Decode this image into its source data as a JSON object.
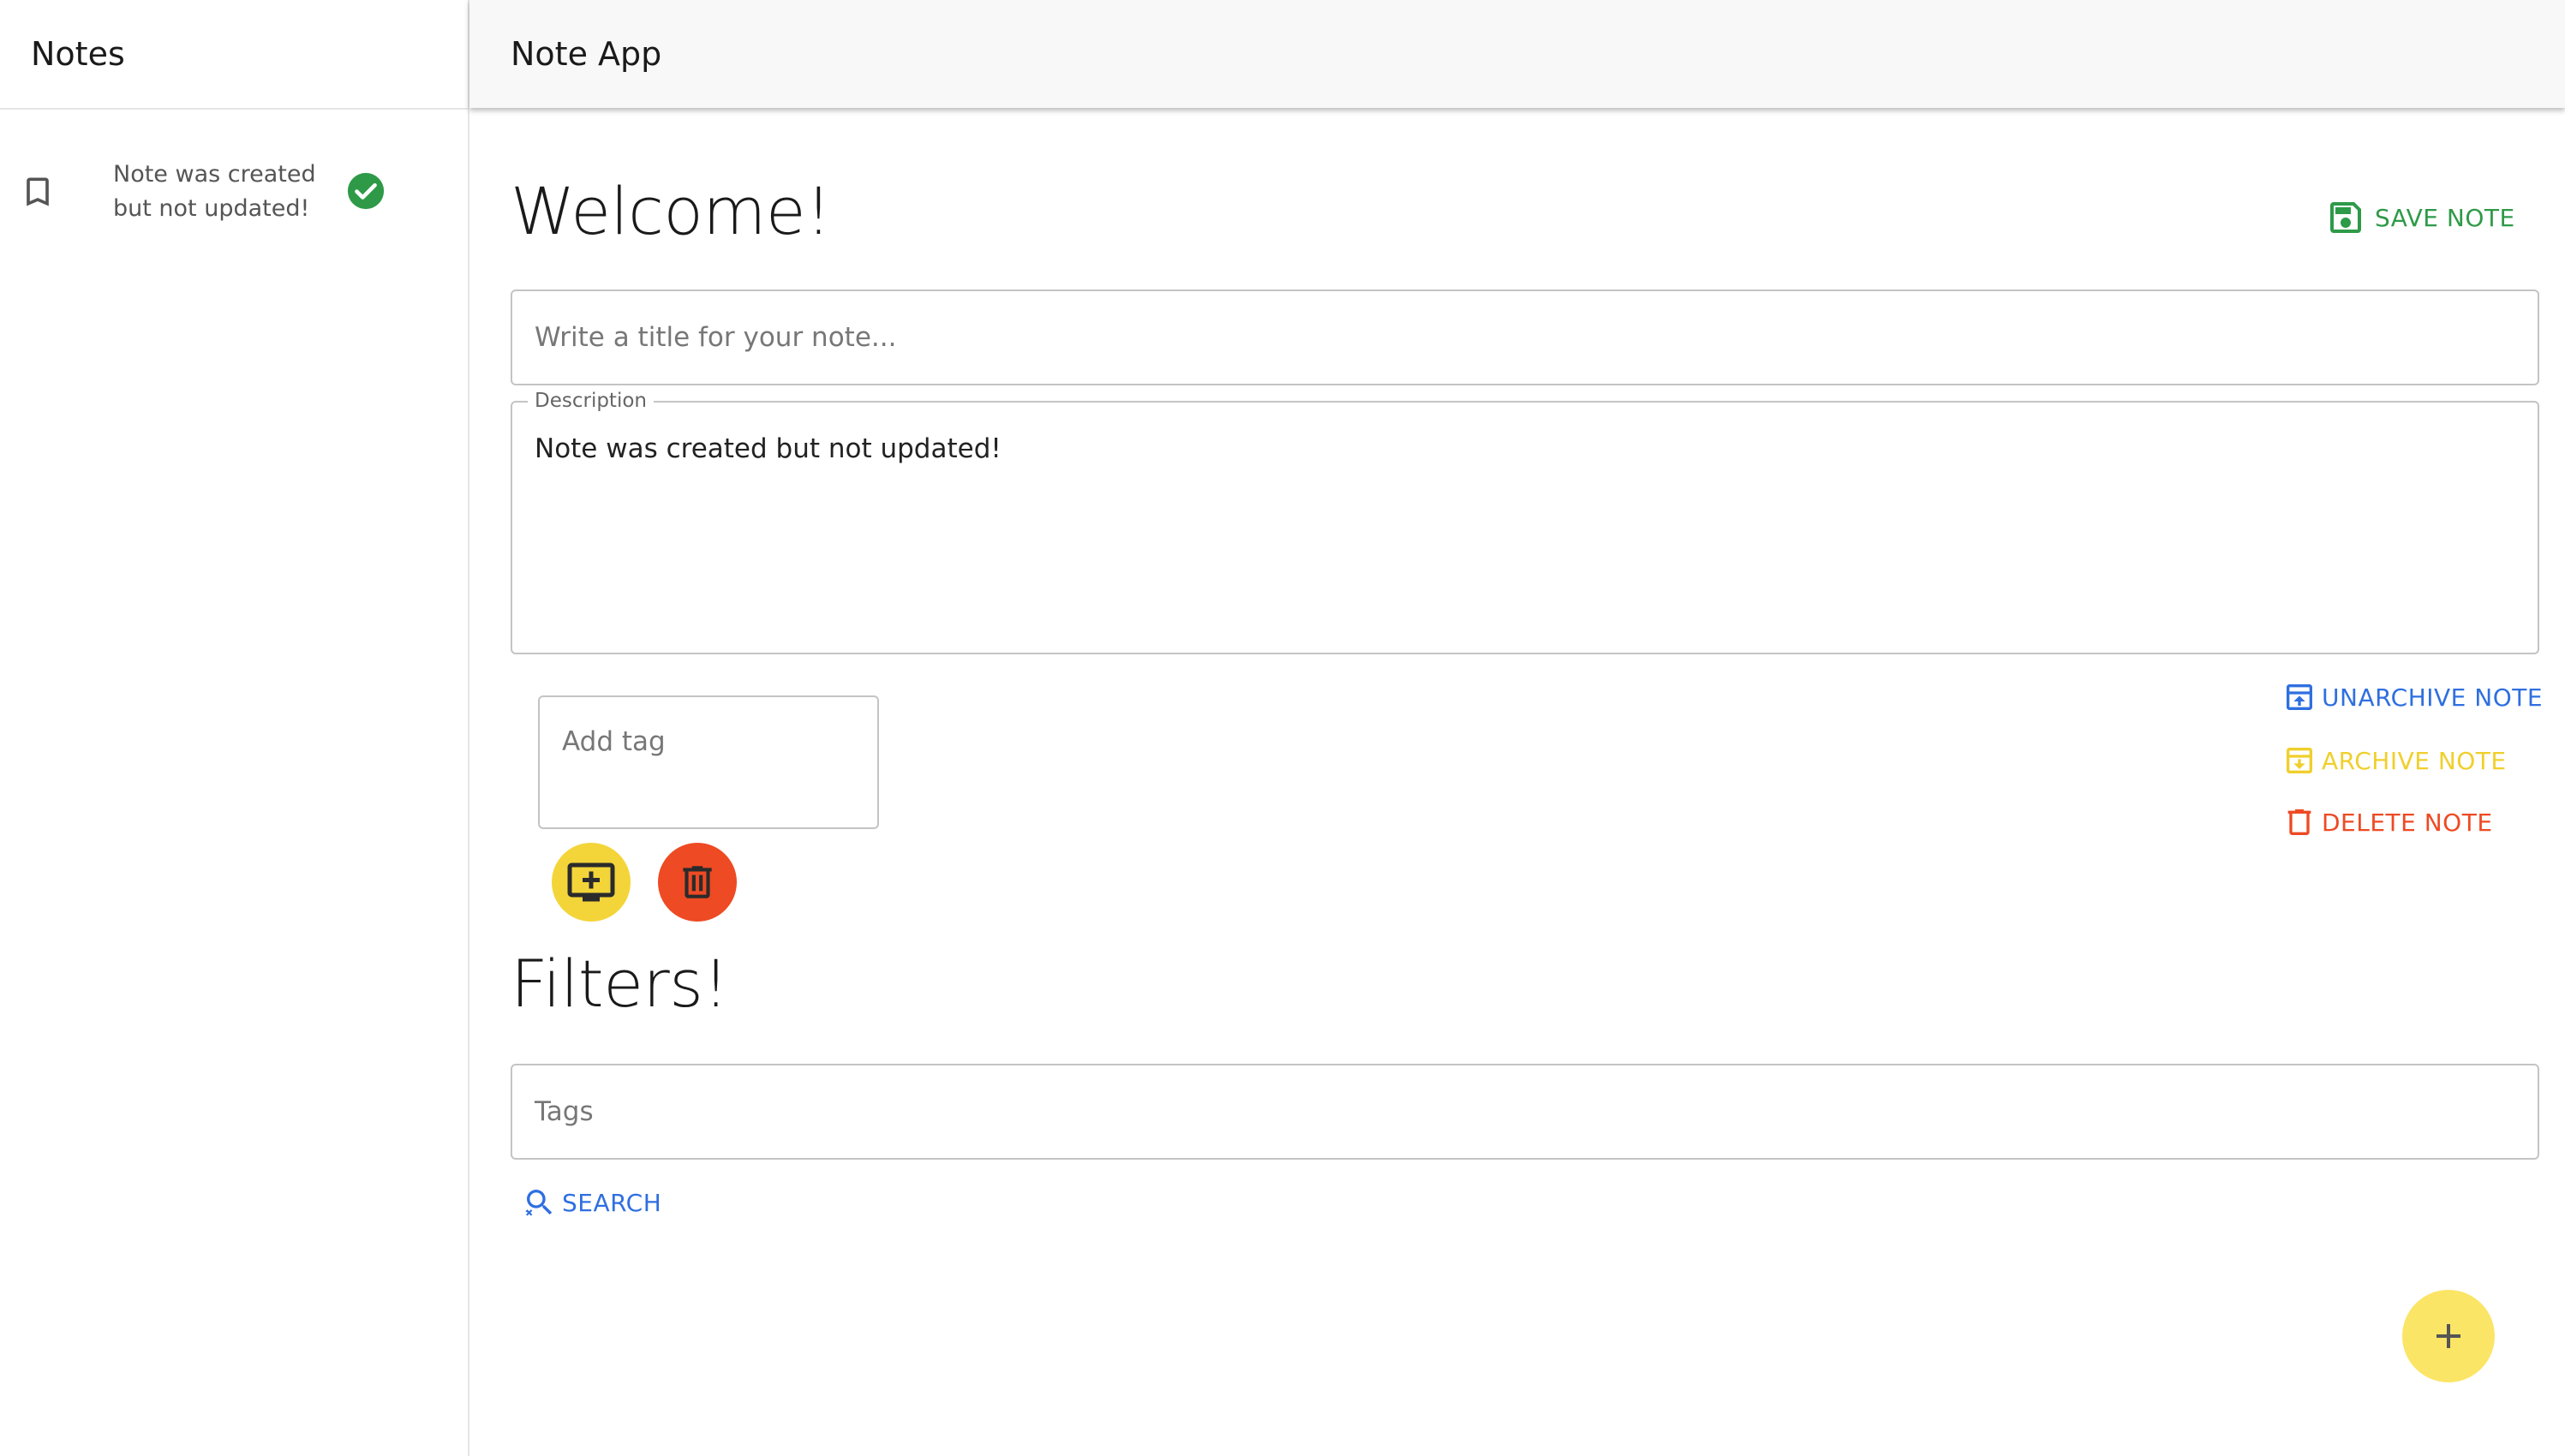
{
  "sidebar": {
    "title": "Notes",
    "notes": [
      {
        "text": "Note was created but not updated!",
        "icon": "bookmark-icon",
        "status_icon": "check-circle-icon"
      }
    ]
  },
  "appbar": {
    "title": "Note App"
  },
  "editor": {
    "heading": "Welcome!",
    "save_label": "SAVE NOTE",
    "title_placeholder": "Write a title for your note...",
    "description_label": "Description",
    "description_value": "Note was created but not updated!",
    "tag_placeholder": "Add tag",
    "unarchive_label": "UNARCHIVE NOTE",
    "archive_label": "ARCHIVE NOTE",
    "delete_label": "DELETE NOTE"
  },
  "filters": {
    "heading": "Filters!",
    "tags_placeholder": "Tags",
    "search_label": "SEARCH"
  },
  "colors": {
    "green": "#2e9a48",
    "blue": "#2f6fe0",
    "yellow": "#f3d53a",
    "orange": "#ee4a23",
    "fab_yellow": "#fbe566"
  }
}
